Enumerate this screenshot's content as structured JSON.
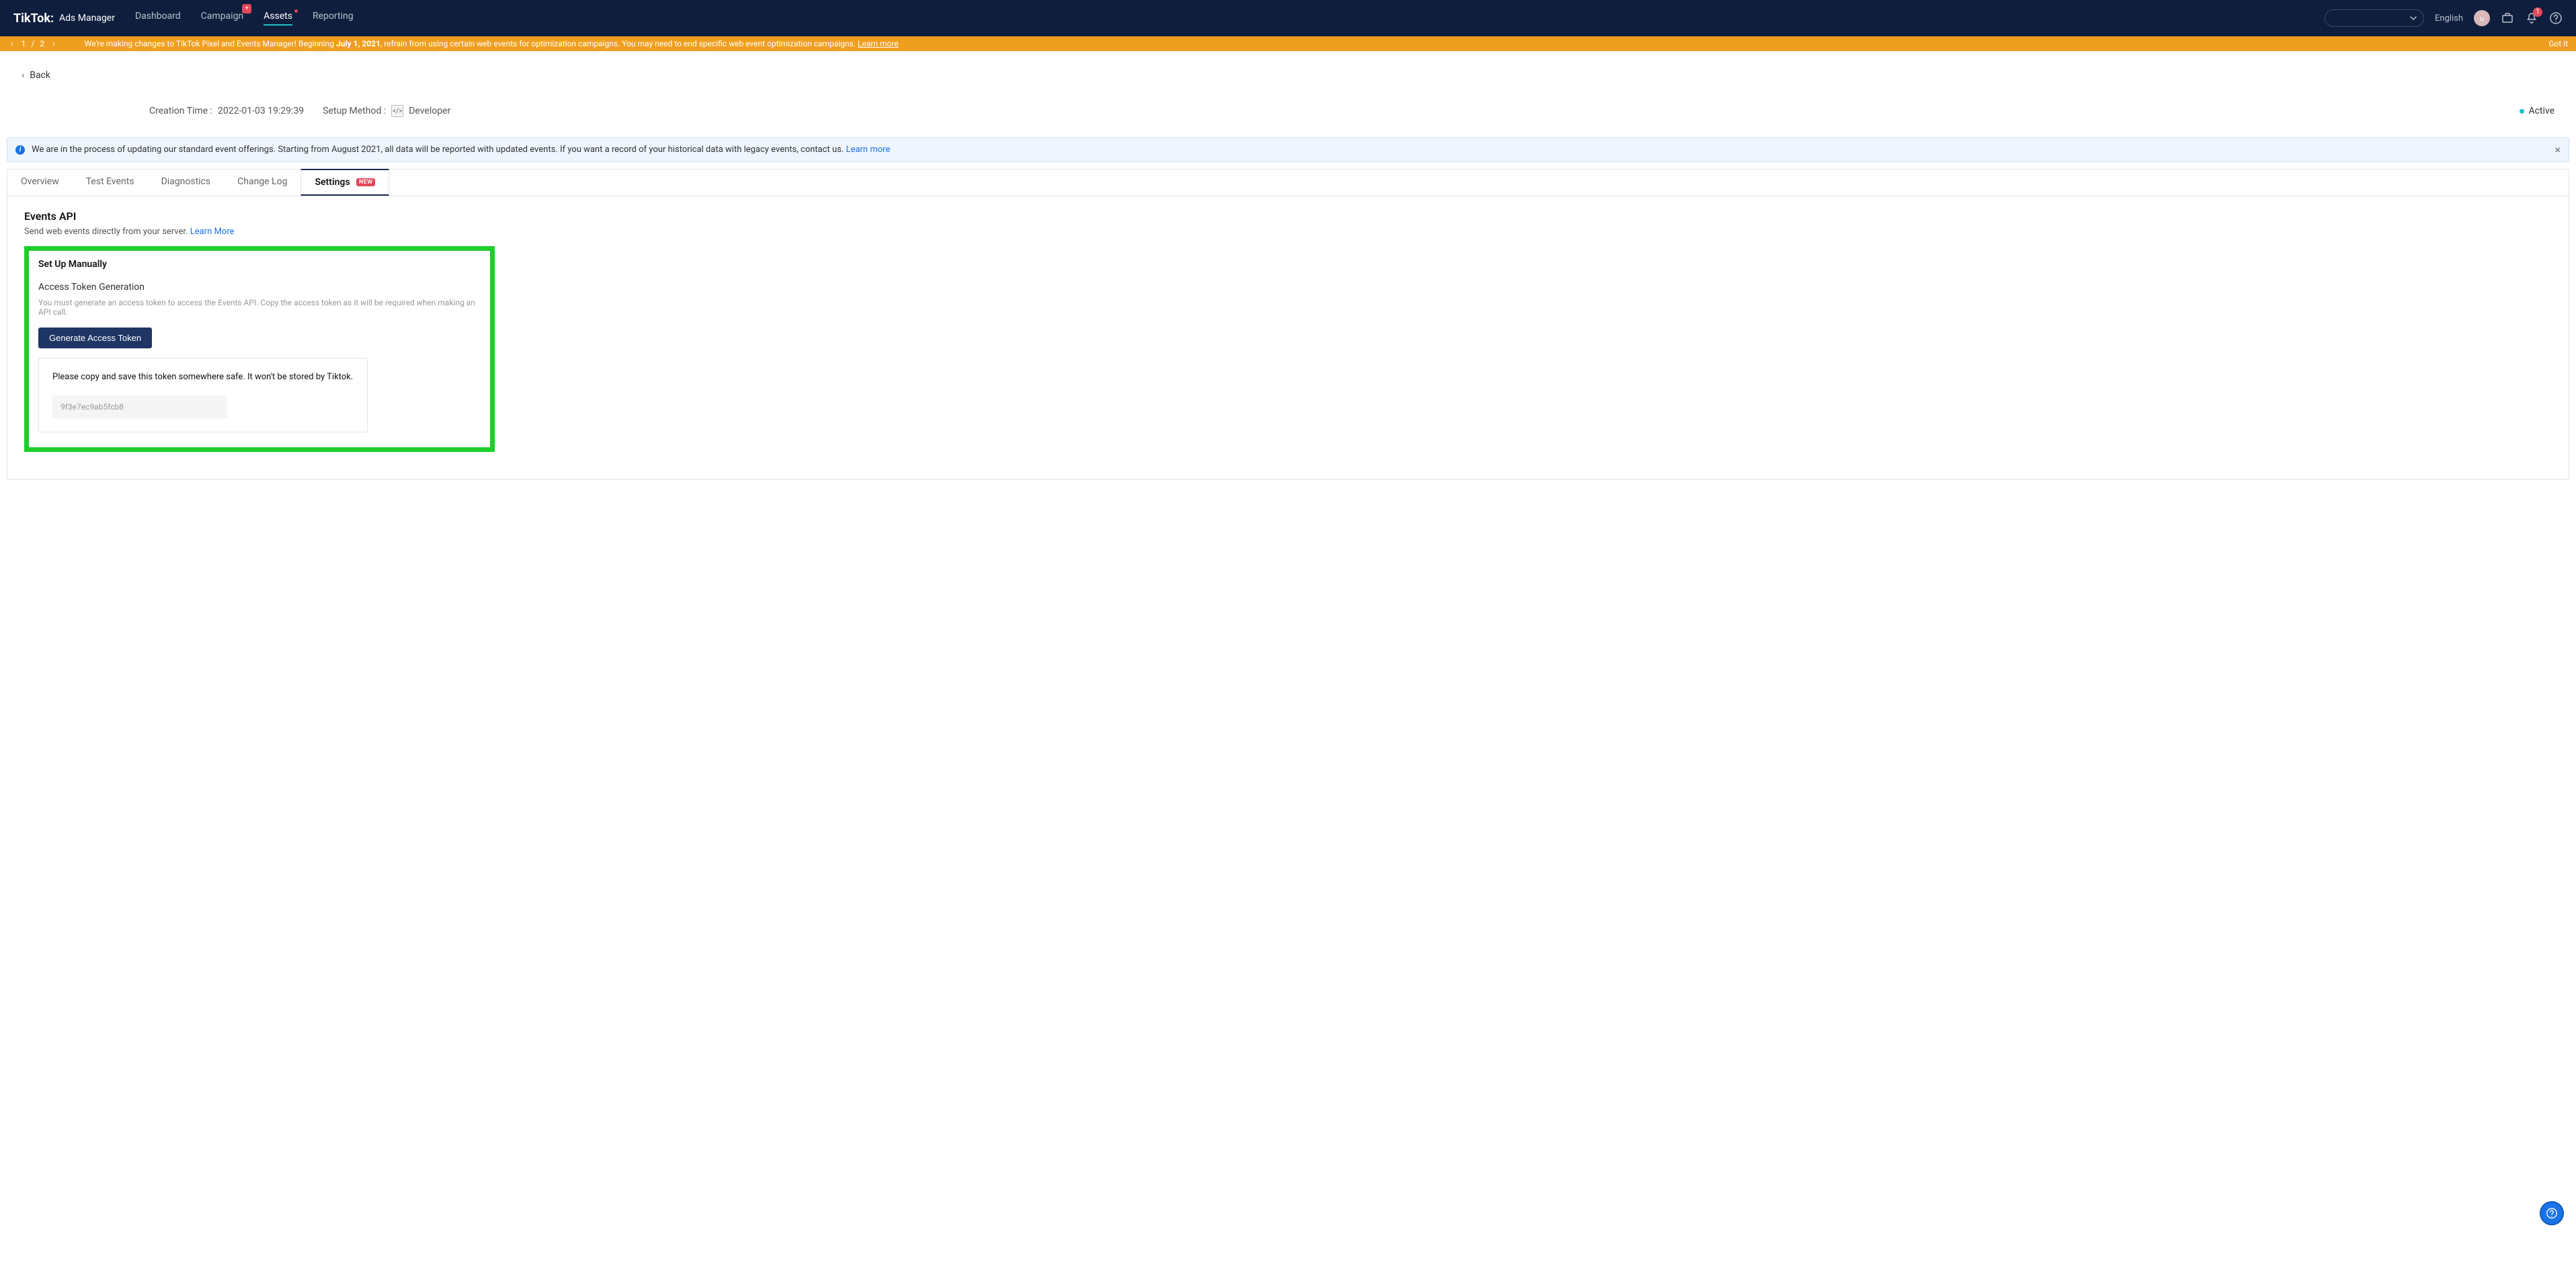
{
  "navbar": {
    "logo": "TikTok:",
    "logo_sub": "Ads Manager",
    "links": {
      "dashboard": "Dashboard",
      "campaign": "Campaign",
      "assets": "Assets",
      "reporting": "Reporting"
    },
    "campaign_badge": "+",
    "language": "English",
    "avatar_letter": "u",
    "notif_count": "1"
  },
  "banner": {
    "page_current": "1",
    "page_total": "2",
    "text_pre": "We're making changes to TikTok Pixel and Events Manager! Beginning ",
    "bold": "July 1, 2021",
    "text_post": ", refrain from using certain web events for optimization campaigns. You may need to end specific web event optimization campaigns. ",
    "learn_more": "Learn more",
    "got_it": "Got it"
  },
  "header": {
    "back": "Back",
    "creation_label": "Creation Time :",
    "creation_value": "2022-01-03 19:29:39",
    "setup_label": "Setup Method :",
    "setup_value": "Developer",
    "status": "Active"
  },
  "alert": {
    "text": "We are in the process of updating our standard event offerings. Starting from August 2021, all data will be reported with updated events. If you want a record of your historical data with legacy events, contact us. ",
    "link": "Learn more"
  },
  "tabs": {
    "overview": "Overview",
    "test_events": "Test Events",
    "diagnostics": "Diagnostics",
    "change_log": "Change Log",
    "settings": "Settings",
    "settings_badge": "NEW"
  },
  "panel": {
    "events_api_title": "Events API",
    "events_api_desc": "Send web events directly from your server. ",
    "events_api_link": "Learn More",
    "setup_title": "Set Up Manually",
    "token_gen_title": "Access Token Generation",
    "token_gen_desc": "You must generate an access token to access the Events API. Copy the access token as it will be required when making an API call.",
    "gen_btn": "Generate Access Token",
    "token_msg": "Please copy and save this token somewhere safe. It won't be stored by Tiktok.",
    "token_value": "9f3e7ec9ab5fcb8"
  }
}
